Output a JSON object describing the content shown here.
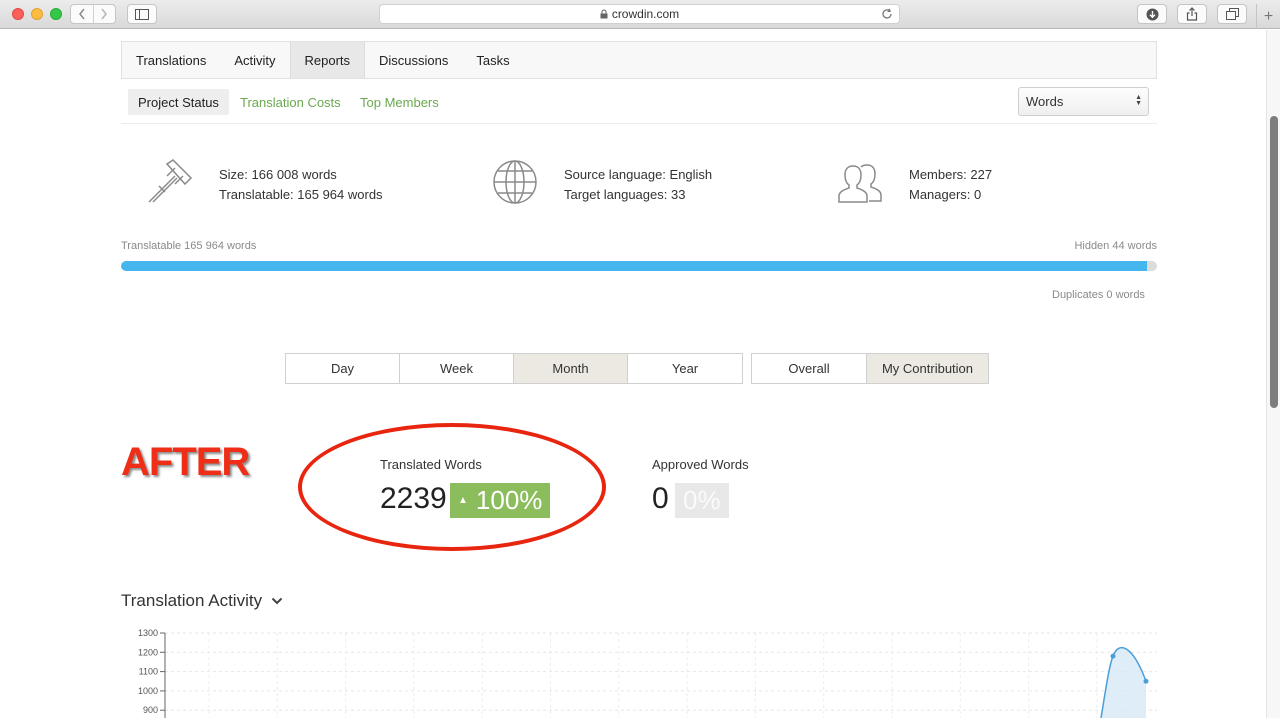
{
  "browser": {
    "url": "crowdin.com"
  },
  "tabs": [
    {
      "label": "Translations"
    },
    {
      "label": "Activity"
    },
    {
      "label": "Reports"
    },
    {
      "label": "Discussions"
    },
    {
      "label": "Tasks"
    }
  ],
  "active_tab": "Reports",
  "subtabs": [
    {
      "label": "Project Status"
    },
    {
      "label": "Translation Costs"
    },
    {
      "label": "Top Members"
    }
  ],
  "unit_select": {
    "value": "Words"
  },
  "stats": {
    "size": "Size: 166 008 words",
    "translatable": "Translatable: 165 964 words",
    "source_language": "Source language: English",
    "target_languages": "Target languages: 33",
    "members": "Members: 227",
    "managers": "Managers: 0"
  },
  "progress": {
    "left_label": "Translatable 165 964 words",
    "right_label": "Hidden 44 words",
    "duplicates_label": "Duplicates 0 words",
    "translatable_fraction": 0.99
  },
  "period_buttons": [
    {
      "label": "Day"
    },
    {
      "label": "Week"
    },
    {
      "label": "Month"
    },
    {
      "label": "Year"
    }
  ],
  "active_period": "Month",
  "scope_buttons": [
    {
      "label": "Overall"
    },
    {
      "label": "My Contribution"
    }
  ],
  "active_scope": "My Contribution",
  "annotation": {
    "text": "AFTER"
  },
  "metrics": {
    "translated": {
      "label": "Translated Words",
      "value": "2239",
      "change": "100%"
    },
    "approved": {
      "label": "Approved Words",
      "value": "0",
      "change": "0%"
    }
  },
  "section": {
    "title": "Translation Activity"
  },
  "chart_data": {
    "type": "area",
    "y_ticks": [
      "1300",
      "1200",
      "1100",
      "1000",
      "900"
    ],
    "ylim": [
      900,
      1300
    ],
    "visible_points": [
      1180,
      1050
    ],
    "colors": {
      "line": "#4a9fd8",
      "fill": "#d6e8f5"
    }
  },
  "colors": {
    "link_green": "#6aa84f",
    "progress_blue": "#45b5ee",
    "badge_green": "#8cbd5d",
    "annotation_red": "#ef2e17"
  }
}
